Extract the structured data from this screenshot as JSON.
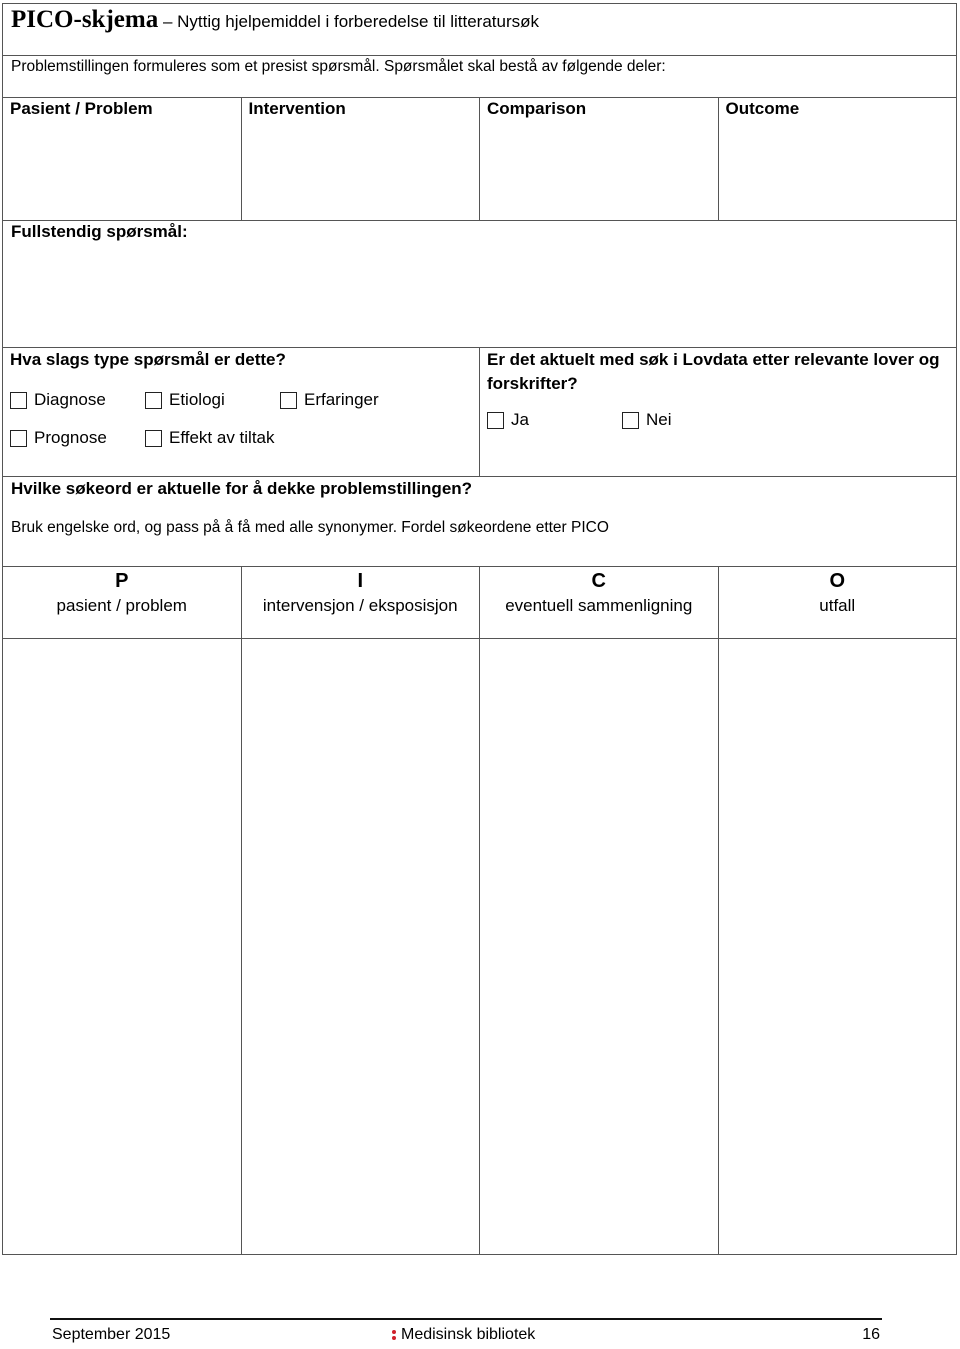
{
  "header": {
    "title": "PICO-skjema",
    "subtitle": " – Nyttig hjelpemiddel i forberedelse til litteratursøk"
  },
  "intro": "Problemstillingen formuleres som et presist spørsmål. Spørsmålet skal bestå av følgende deler:",
  "pico_columns": [
    "Pasient / Problem",
    "Intervention",
    "Comparison",
    "Outcome"
  ],
  "full_question_label": "Fullstendig spørsmål:",
  "question_type": {
    "title": "Hva slags type spørsmål er dette?",
    "options_row1": [
      "Diagnose",
      "Etiologi",
      "Erfaringer"
    ],
    "options_row2": [
      "Prognose",
      "Effekt av tiltak"
    ]
  },
  "lovdata": {
    "title": "Er det aktuelt med søk i Lovdata etter relevante lover og forskrifter?",
    "options": [
      "Ja",
      "Nei"
    ]
  },
  "search_terms": {
    "title": "Hvilke søkeord er aktuelle for å dekke problemstillingen?",
    "instruction": "Bruk engelske ord, og pass på å få med alle synonymer. Fordel søkeordene etter PICO"
  },
  "term_columns": [
    {
      "letter": "P",
      "desc": "pasient / problem"
    },
    {
      "letter": "I",
      "desc": "intervensjon / eksposisjon"
    },
    {
      "letter": "C",
      "desc": "eventuell sammenligning"
    },
    {
      "letter": "O",
      "desc": "utfall"
    }
  ],
  "footer": {
    "date": "September 2015",
    "brand": "Medisinsk bibliotek",
    "page": "16",
    "brand_color": "#d0212b"
  }
}
